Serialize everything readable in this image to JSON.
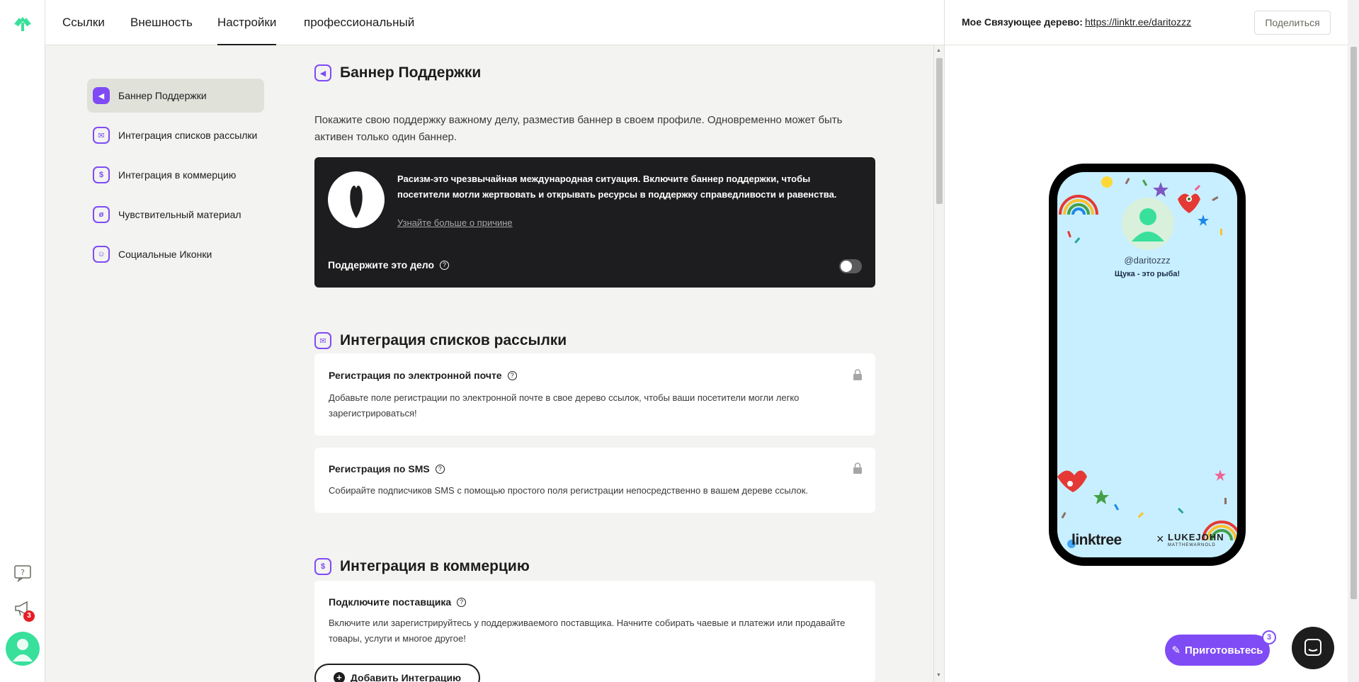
{
  "tabs": [
    "Ссылки",
    "Внешность",
    "Настройки",
    "профессиональный"
  ],
  "active_tab": "Настройки",
  "rail": {
    "notifications_badge": "3"
  },
  "sidebar": {
    "items": [
      {
        "label": "Баннер Поддержки",
        "icon": "megaphone-icon"
      },
      {
        "label": "Интеграция списков рассылки",
        "icon": "mail-icon"
      },
      {
        "label": "Интеграция в коммерцию",
        "icon": "dollar-icon"
      },
      {
        "label": "Чувствительный материал",
        "icon": "eye-off-icon"
      },
      {
        "label": "Социальные Иконки",
        "icon": "smiley-icon"
      }
    ]
  },
  "support_banner": {
    "title": "Баннер Поддержки",
    "description": "Покажите свою поддержку важному делу, разместив баннер в своем профиле. Одновременно может быть активен только один баннер.",
    "banner_text": "Расизм-это чрезвычайная международная ситуация. Включите баннер поддержки, чтобы посетители могли жертвовать и открывать ресурсы в поддержку справедливости и равенства.",
    "learn_more": "Узнайте больше о причине",
    "toggle_label": "Поддержите это дело",
    "toggle_on": false
  },
  "mailing": {
    "title": "Интеграция списков рассылки",
    "cards": [
      {
        "title": "Регистрация по электронной почте",
        "text": "Добавьте поле регистрации по электронной почте в свое дерево ссылок, чтобы ваши посетители могли легко зарегистрироваться!"
      },
      {
        "title": "Регистрация по SMS",
        "text": "Собирайте подписчиков SMS с помощью простого поля регистрации непосредственно в вашем дереве ссылок."
      }
    ]
  },
  "commerce": {
    "title": "Интеграция в коммерцию",
    "card_title": "Подключите поставщика",
    "card_text": "Включите или зарегистрируйтесь у поддерживаемого поставщика. Начните собирать чаевые и платежи или продавайте товары, услуги и многое другое!",
    "add_button": "Добавить Интеграцию"
  },
  "preview": {
    "label": "Мое Связующее дерево:",
    "url": "https://linktr.ee/daritozzz",
    "share": "Поделиться",
    "handle": "@daritozzz",
    "bio": "Щука - это рыба!",
    "brand": "linktree",
    "brand_x": "×",
    "collab": "LUKEJOHN",
    "collab_sub": "MATTHEWARNOLD"
  },
  "prepare_button": "Приготовьтесь",
  "prepare_badge": "3",
  "colors": {
    "accent": "#7f4bf5",
    "brand_green": "#39e09b",
    "banner_bg": "#1d1d1f"
  }
}
